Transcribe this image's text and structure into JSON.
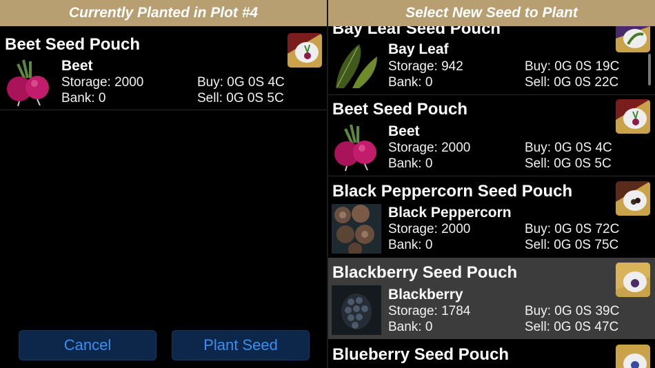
{
  "header": {
    "left_title": "Currently Planted in Plot #4",
    "right_title": "Select New Seed to Plant"
  },
  "current": {
    "pouch_title": "Beet Seed Pouch",
    "name": "Beet",
    "storage": "Storage: 2000",
    "bank": "Bank: 0",
    "buy": "Buy: 0G 0S 4C",
    "sell": "Sell: 0G 0S 5C"
  },
  "seed_list": [
    {
      "pouch_title": "Bay Leaf Seed Pouch",
      "name": "Bay Leaf",
      "storage": "Storage: 942",
      "bank": "Bank: 0",
      "buy": "Buy: 0G 0S 19C",
      "sell": "Sell: 0G 0S 22C"
    },
    {
      "pouch_title": "Beet Seed Pouch",
      "name": "Beet",
      "storage": "Storage: 2000",
      "bank": "Bank: 0",
      "buy": "Buy: 0G 0S 4C",
      "sell": "Sell: 0G 0S 5C"
    },
    {
      "pouch_title": "Black Peppercorn Seed Pouch",
      "name": "Black Peppercorn",
      "storage": "Storage: 2000",
      "bank": "Bank: 0",
      "buy": "Buy: 0G 0S 72C",
      "sell": "Sell: 0G 0S 75C"
    },
    {
      "pouch_title": "Blackberry Seed Pouch",
      "name": "Blackberry",
      "storage": "Storage: 1784",
      "bank": "Bank: 0",
      "buy": "Buy: 0G 0S 39C",
      "sell": "Sell: 0G 0S 47C"
    },
    {
      "pouch_title": "Blueberry Seed Pouch"
    }
  ],
  "buttons": {
    "cancel": "Cancel",
    "plant": "Plant Seed"
  },
  "colors": {
    "header_bg": "#b89f72",
    "button_bg": "#0c2749",
    "button_text": "#3b8ef2",
    "selected_row": "#3c3c3c"
  }
}
